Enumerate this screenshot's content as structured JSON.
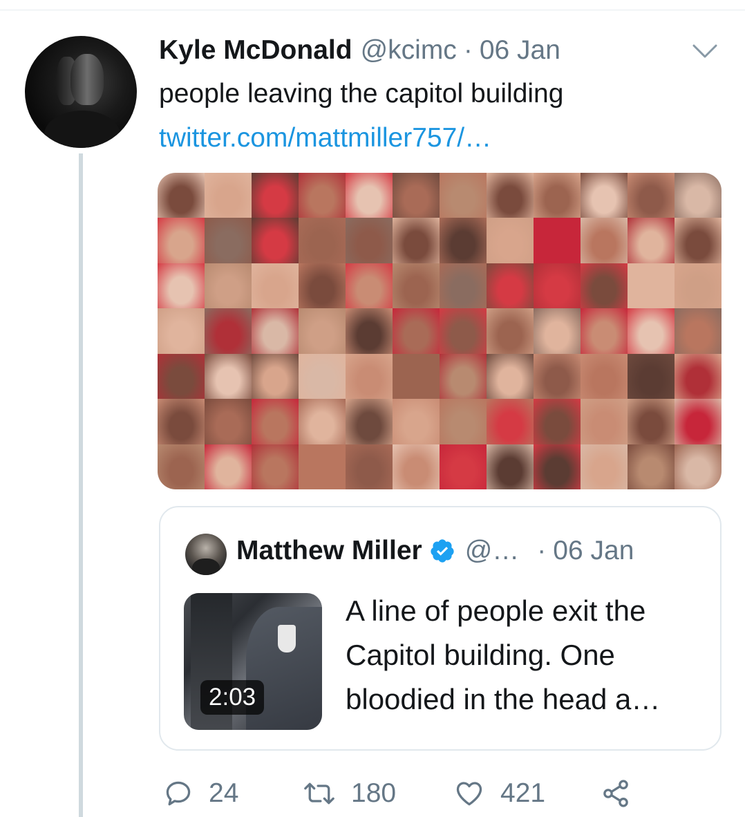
{
  "tweet": {
    "author_name": "Kyle McDonald",
    "author_handle": "@kcimc",
    "separator": "·",
    "time": "06 Jan",
    "text": "people leaving the capitol building",
    "link": "twitter.com/mattmiller757/…",
    "media_image": "grid-of-faces-photo",
    "avatar_image": "profile-photo"
  },
  "quote": {
    "author_name": "Matthew Miller",
    "author_handle": "@…",
    "separator": "·",
    "time": "06 Jan",
    "video_duration": "2:03",
    "text_lines": [
      "A line of people exit the",
      "Capitol building. One",
      "bloodied in the head a…"
    ],
    "verified_icon": "verified-badge-icon"
  },
  "actions": {
    "reply_count": "24",
    "retweet_count": "180",
    "like_count": "421"
  },
  "colors": {
    "text": "#14171a",
    "secondary": "#657786",
    "link": "#1b95e0",
    "verified": "#1da1f2",
    "border": "#e1e8ed",
    "thread_line": "#cfd9de"
  }
}
